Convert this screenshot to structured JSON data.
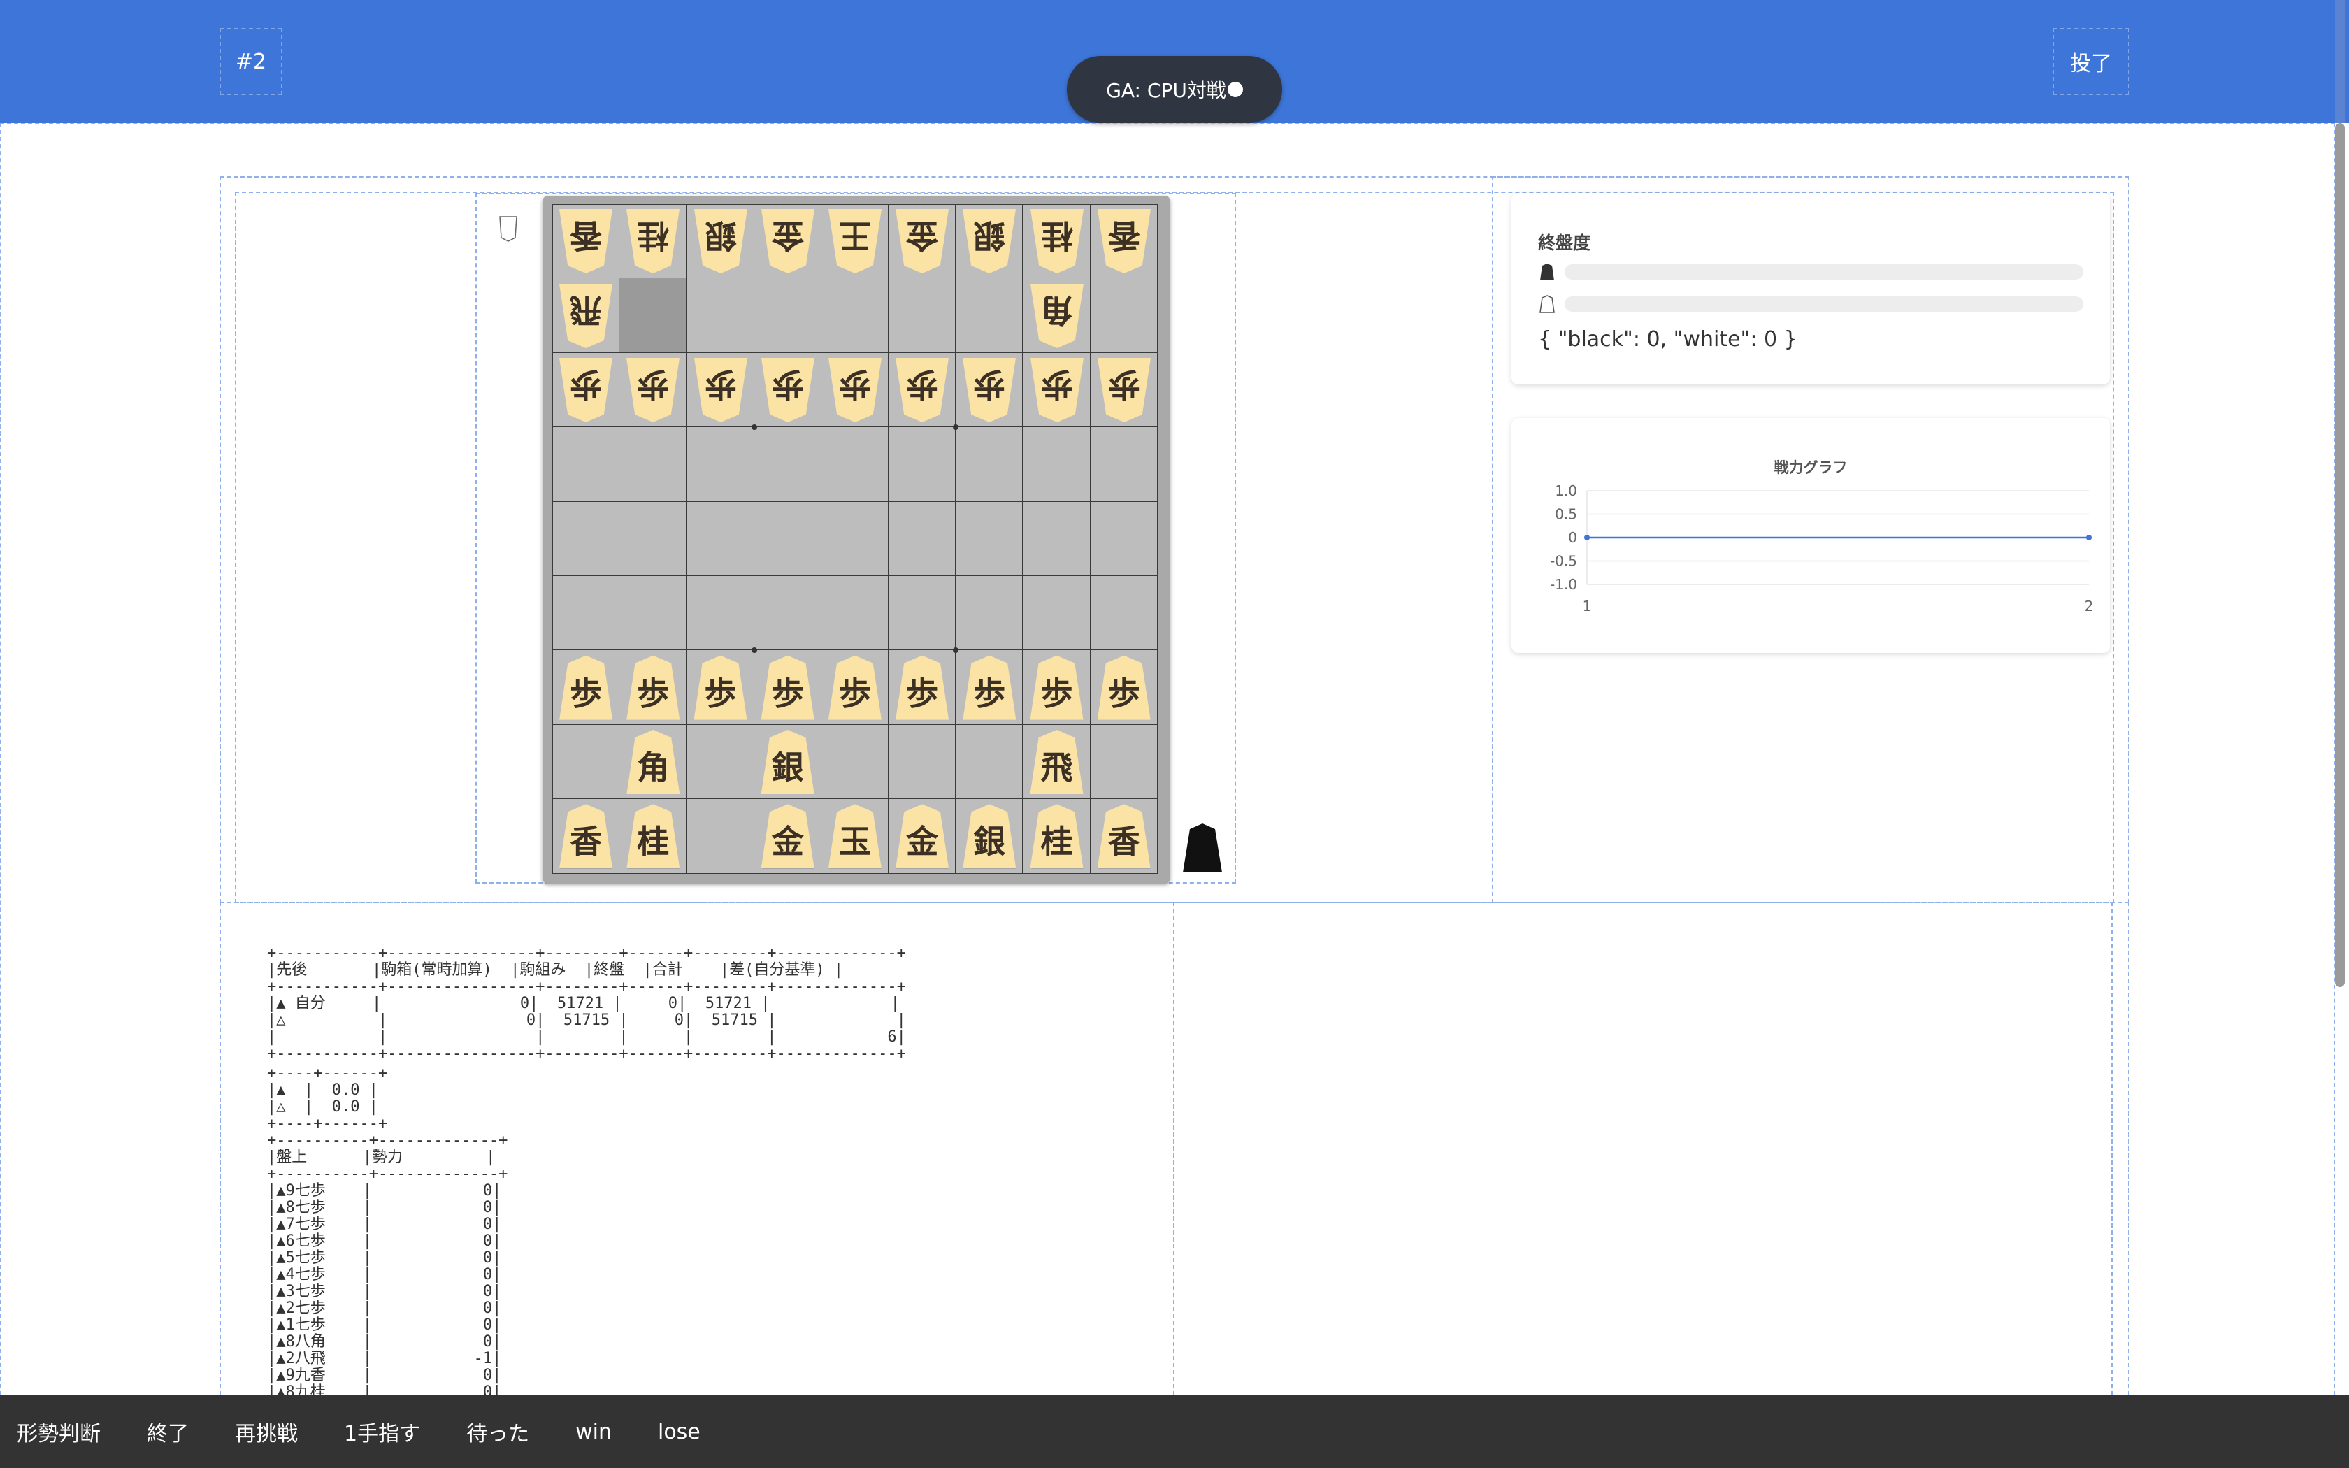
{
  "header": {
    "game_number": "#2",
    "resign_label": "投了",
    "mode_label": "GA: CPU対戦"
  },
  "board": {
    "gote_rows": [
      [
        "香",
        "桂",
        "銀",
        "金",
        "王",
        "金",
        "銀",
        "桂",
        "香"
      ],
      [
        "飛",
        "",
        "",
        "",
        "",
        "",
        "",
        "角",
        ""
      ],
      [
        "歩",
        "歩",
        "歩",
        "歩",
        "歩",
        "歩",
        "歩",
        "歩",
        "歩"
      ]
    ],
    "sente_rows": [
      [
        "歩",
        "歩",
        "歩",
        "歩",
        "歩",
        "歩",
        "歩",
        "歩",
        "歩"
      ],
      [
        "",
        "角",
        "",
        "銀",
        "",
        "",
        "",
        "飛",
        ""
      ],
      [
        "香",
        "桂",
        "",
        "金",
        "玉",
        "金",
        "銀",
        "桂",
        "香"
      ]
    ],
    "highlight_cell": "8二"
  },
  "endgame_panel": {
    "title": "終盤度",
    "black_progress": 0,
    "white_progress": 0,
    "json_text": "{ \"black\": 0, \"white\": 0 }"
  },
  "chart_data": {
    "type": "line",
    "title": "戦力グラフ",
    "x": [
      1,
      2
    ],
    "series": [
      {
        "values": [
          0,
          0
        ]
      }
    ],
    "yticks": [
      "1.0",
      "0.5",
      "0",
      "-0.5",
      "-1.0"
    ],
    "xticks": [
      "1",
      "2"
    ],
    "ylim": [
      -1.0,
      1.0
    ],
    "grid": true
  },
  "evaluation": {
    "table1": "+-----------+----------------+--------+------+--------+-------------+\n|先後       |駒箱(常時加算)  |駒組み  |終盤  |合計    |差(自分基準) |\n+-----------+----------------+--------+------+--------+-------------+\n|▲ 自分     |               0|  51721 |     0|  51721 |             |\n|△          |               0|  51715 |     0|  51715 |             |\n|           |                |        |      |        |            6|\n+-----------+----------------+--------+------+--------+-------------+",
    "table2": "+----+------+\n|▲  |  0.0 |\n|△  |  0.0 |\n+----+------+",
    "table3": "+----------+-------------+\n|盤上      |勢力         |\n+----------+-------------+\n|▲9七歩    |            0|\n|▲8七歩    |            0|\n|▲7七歩    |            0|\n|▲6七歩    |            0|\n|▲5七歩    |            0|\n|▲4七歩    |            0|\n|▲3七歩    |            0|\n|▲2七歩    |            0|\n|▲1七歩    |            0|\n|▲8八角    |            0|\n|▲2八飛    |           -1|\n|▲9九香    |            0|\n|▲8九桂    |            0|"
  },
  "menu": {
    "items": [
      "形勢判断",
      "終了",
      "再挑戦",
      "1手指す",
      "待った",
      "win",
      "lose"
    ]
  }
}
